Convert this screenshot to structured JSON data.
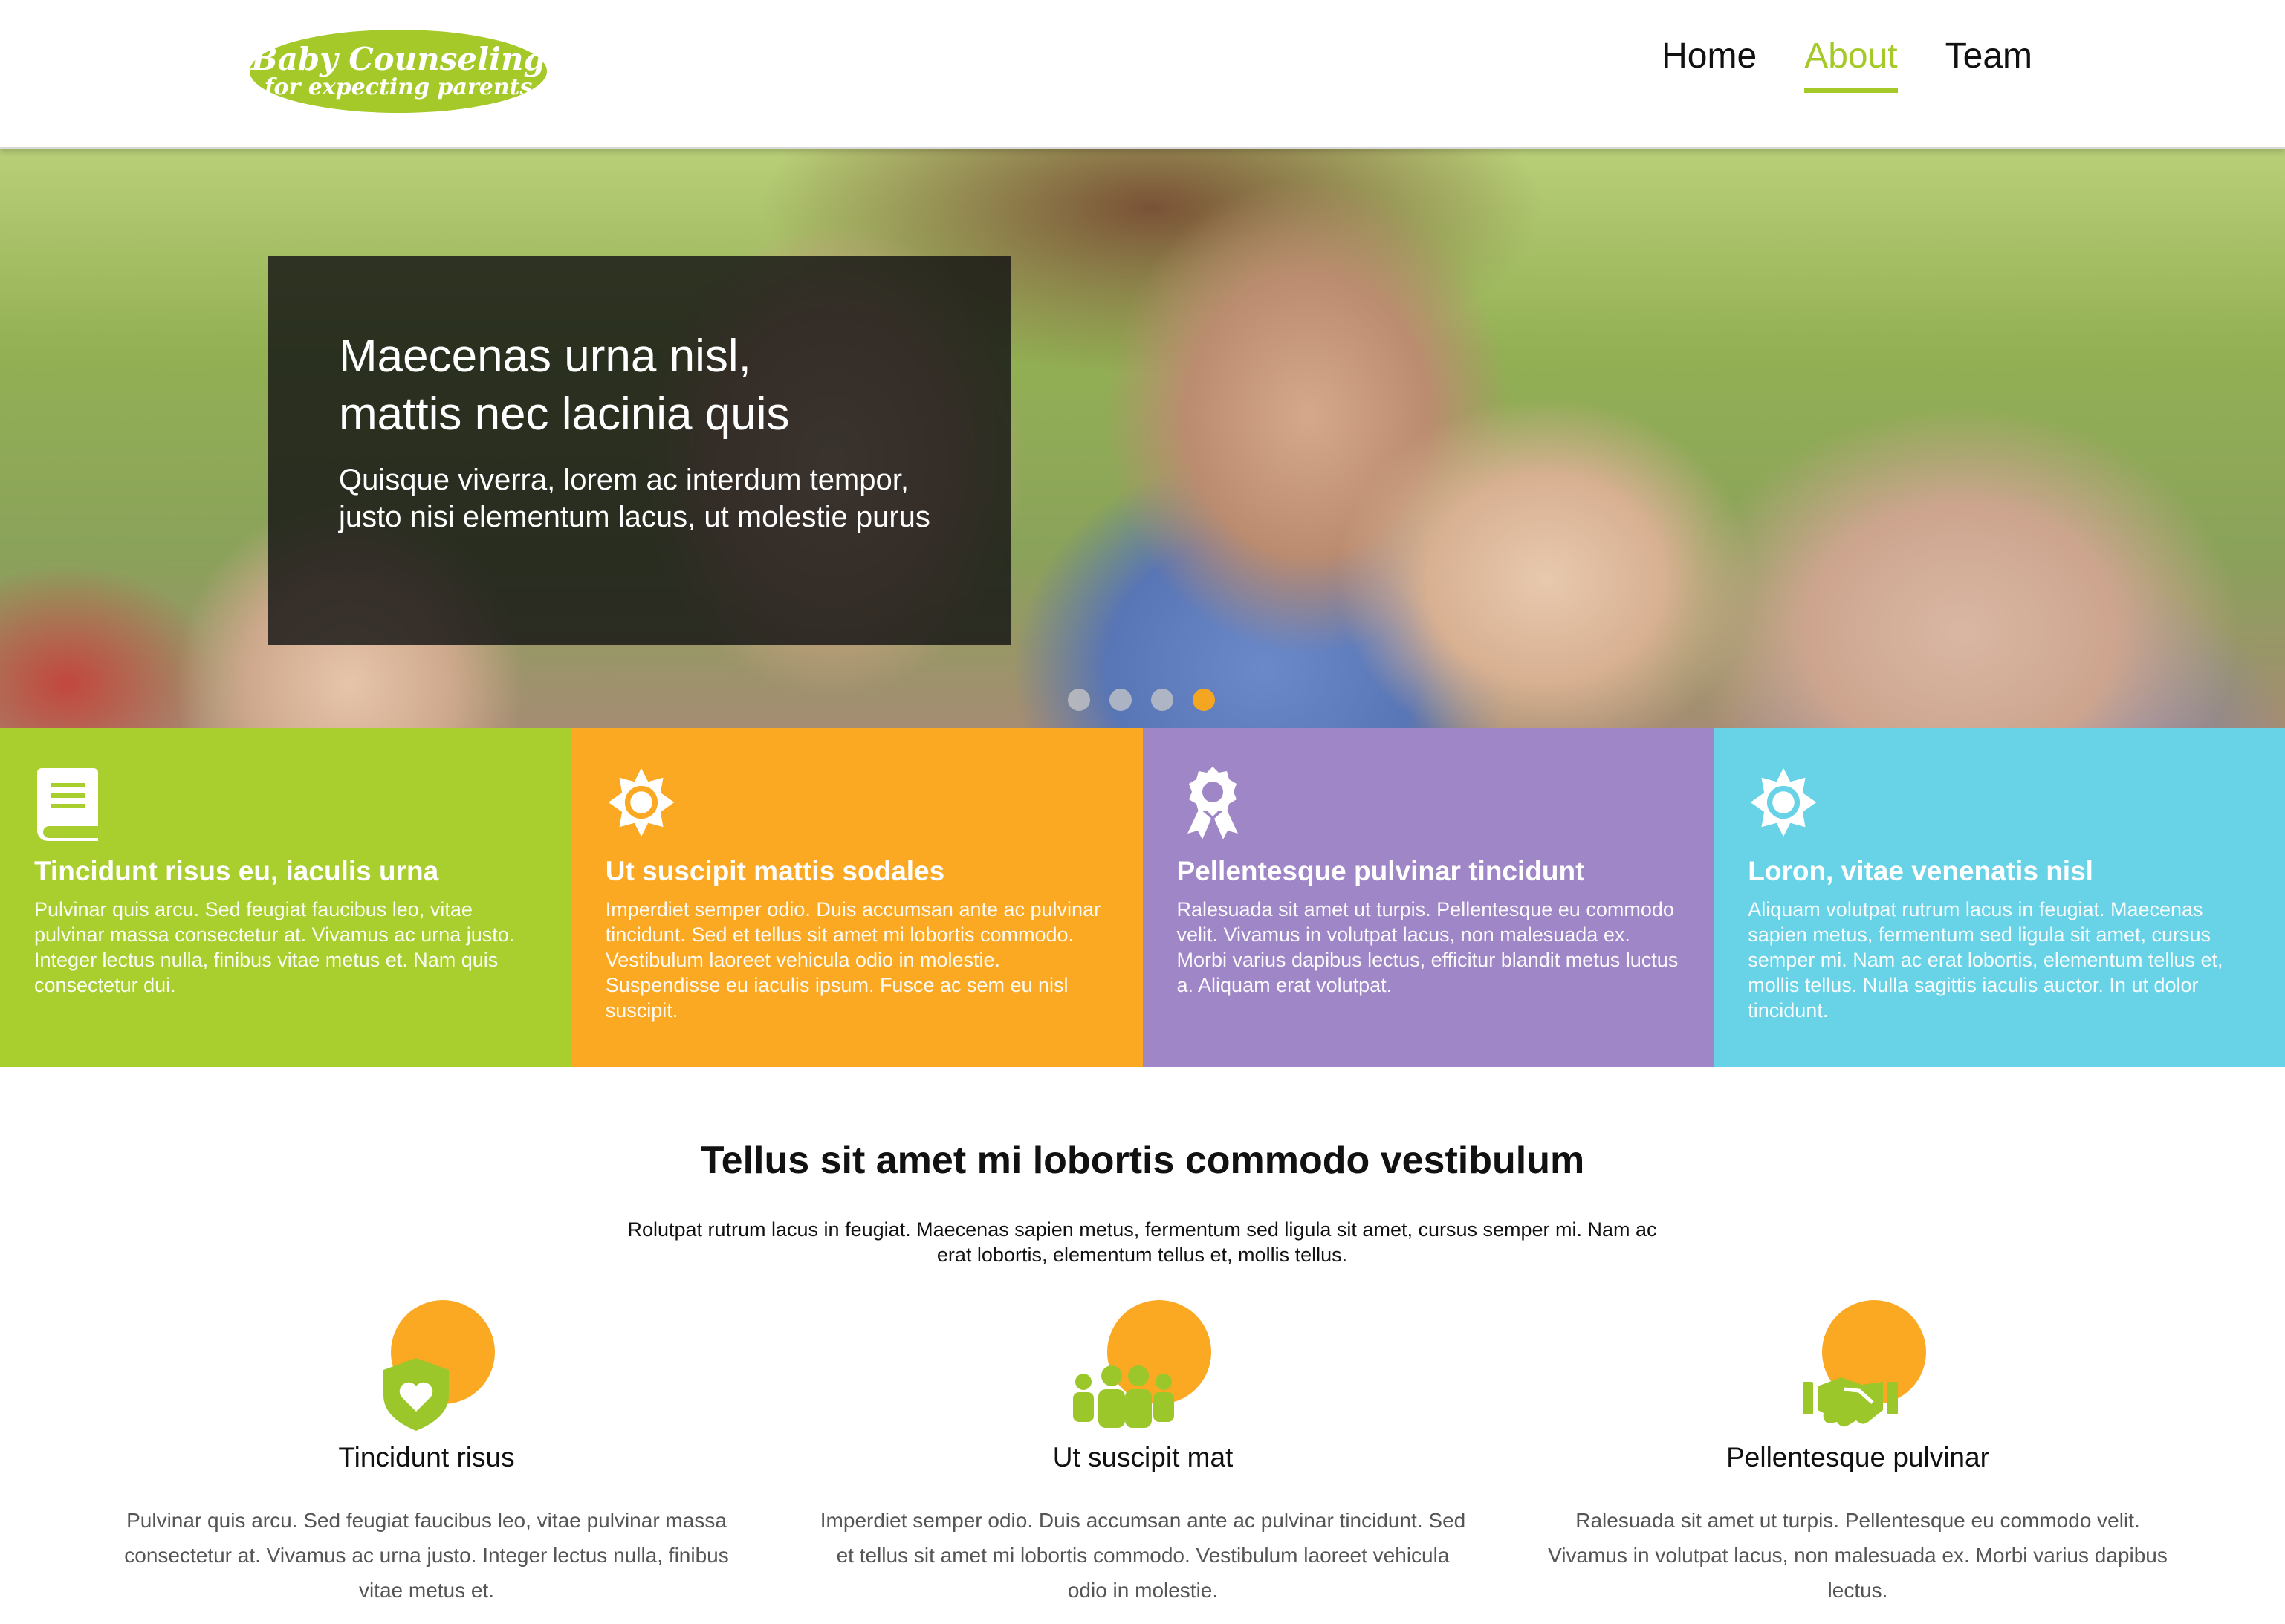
{
  "logo": {
    "line1": "Baby Counseling",
    "line2": "for expecting parents"
  },
  "nav": [
    {
      "label": "Home",
      "active": false
    },
    {
      "label": "About",
      "active": true
    },
    {
      "label": "Team",
      "active": false
    }
  ],
  "hero": {
    "title_line1": "Maecenas urna nisl,",
    "title_line2": "mattis nec lacinia quis",
    "subtitle": "Quisque viverra, lorem ac interdum tempor, justo nisi elementum lacus, ut molestie purus",
    "slides": 4,
    "active_slide": 4
  },
  "tiles": [
    {
      "icon": "book-icon",
      "color": "#a9cf2e",
      "title": "Tincidunt risus eu, iaculis urna",
      "text": "Pulvinar quis arcu. Sed feugiat faucibus leo, vitae pulvinar massa consectetur at. Vivamus ac urna justo. Integer lectus nulla, finibus vitae metus et. Nam quis consectetur dui."
    },
    {
      "icon": "sun-icon",
      "color": "#fba823",
      "title": "Ut suscipit mattis sodales",
      "text": "Imperdiet semper odio. Duis accumsan ante ac pulvinar tincidunt. Sed et tellus sit amet mi lobortis commodo. Vestibulum laoreet vehicula odio in molestie. Suspendisse eu iaculis ipsum. Fusce ac sem eu nisl suscipit."
    },
    {
      "icon": "award-icon",
      "color": "#9f86c6",
      "title": "Pellentesque pulvinar tincidunt",
      "text": "Ralesuada sit amet ut turpis. Pellentesque eu commodo velit. Vivamus in volutpat lacus, non malesuada ex. Morbi varius dapibus lectus, efficitur blandit metus luctus a. Aliquam erat volutpat."
    },
    {
      "icon": "sun-icon",
      "color": "#68d2e7",
      "title": "Loron, vitae venenatis nisl",
      "text": "Aliquam volutpat rutrum lacus in feugiat. Maecenas sapien metus, fermentum sed ligula sit amet, cursus semper mi. Nam ac erat lobortis, elementum tellus et, mollis tellus. Nulla sagittis iaculis auctor. In ut dolor tincidunt."
    }
  ],
  "intro": {
    "heading": "Tellus sit amet mi lobortis commodo vestibulum",
    "text": "Rolutpat rutrum lacus in feugiat. Maecenas sapien metus, fermentum sed ligula sit amet, cursus semper mi. Nam ac erat lobortis, elementum tellus et, mollis tellus."
  },
  "columns": [
    {
      "icon": "shield-heart-icon",
      "title": "Tincidunt risus",
      "text": "Pulvinar quis arcu. Sed feugiat faucibus leo, vitae pulvinar massa consectetur at. Vivamus ac urna justo. Integer lectus nulla, finibus vitae metus et."
    },
    {
      "icon": "family-icon",
      "title": "Ut suscipit mat",
      "text": "Imperdiet semper odio. Duis accumsan ante ac pulvinar tincidunt. Sed et tellus sit amet mi lobortis commodo. Vestibulum laoreet vehicula odio in molestie."
    },
    {
      "icon": "handshake-icon",
      "title": "Pellentesque pulvinar",
      "text": "Ralesuada sit amet ut turpis. Pellentesque eu commodo velit. Vivamus in volutpat lacus, non malesuada ex. Morbi varius dapibus lectus."
    }
  ],
  "colors": {
    "accent_green": "#a4c928",
    "accent_orange": "#f4a623"
  }
}
